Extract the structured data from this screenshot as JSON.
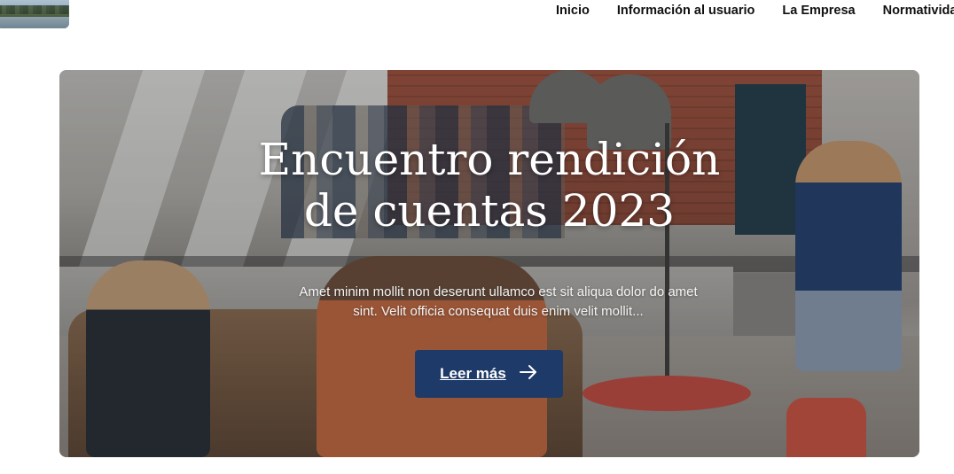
{
  "nav": {
    "items": [
      {
        "label": "Inicio"
      },
      {
        "label": "Información al usuario"
      },
      {
        "label": "La Empresa"
      },
      {
        "label": "Normatividad"
      }
    ]
  },
  "hero": {
    "title_line1": "Encuentro rendición",
    "title_line2": "de cuentas 2023",
    "description_line1": "Amet minim mollit non deserunt ullamco est sit aliqua dolor do amet",
    "description_line2": "sint. Velit officia consequat duis enim velit mollit...",
    "cta_label": "Leer más",
    "cta_icon": "arrow-right-icon"
  },
  "colors": {
    "cta_background": "#1e3a68",
    "nav_text": "#111111",
    "hero_text": "#ffffff"
  }
}
